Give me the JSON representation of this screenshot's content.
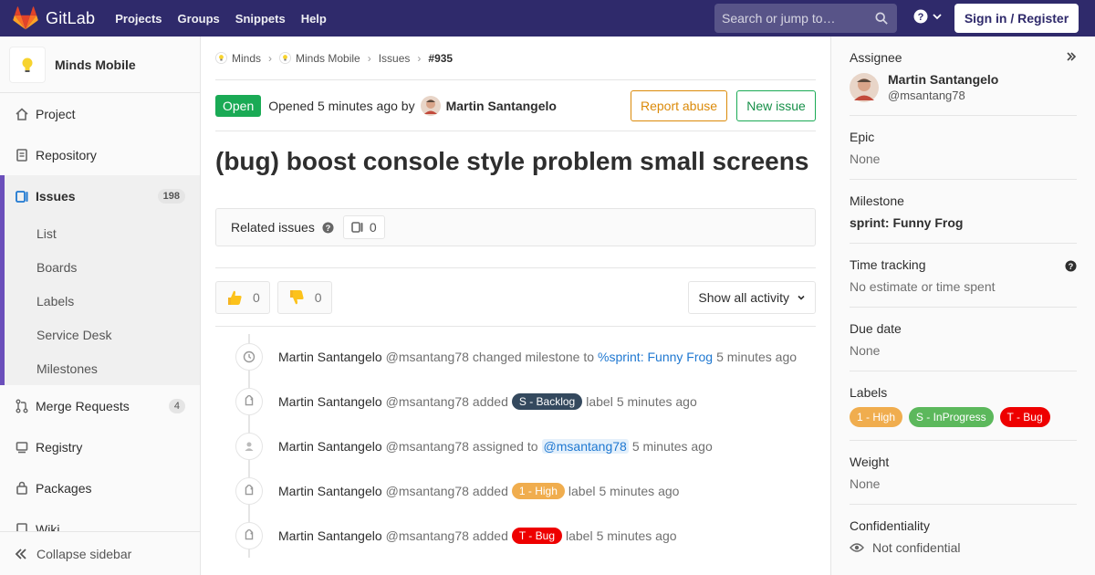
{
  "topbar": {
    "brand": "GitLab",
    "nav": [
      "Projects",
      "Groups",
      "Snippets",
      "Help"
    ],
    "search_placeholder": "Search or jump to…",
    "signin": "Sign in / Register"
  },
  "sidebar": {
    "project_name": "Minds Mobile",
    "items": [
      {
        "label": "Project",
        "icon": "home-icon"
      },
      {
        "label": "Repository",
        "icon": "doc-icon"
      },
      {
        "label": "Issues",
        "icon": "issues-icon",
        "count": "198",
        "active": true
      }
    ],
    "issue_subitems": [
      "List",
      "Boards",
      "Labels",
      "Service Desk",
      "Milestones"
    ],
    "items_after": [
      {
        "label": "Merge Requests",
        "icon": "merge-request-icon",
        "count": "4"
      },
      {
        "label": "Registry",
        "icon": "registry-icon"
      },
      {
        "label": "Packages",
        "icon": "package-icon"
      },
      {
        "label": "Wiki",
        "icon": "wiki-icon"
      }
    ],
    "collapse": "Collapse sidebar"
  },
  "breadcrumb": {
    "group": "Minds",
    "project": "Minds Mobile",
    "section": "Issues",
    "current": "#935"
  },
  "issue": {
    "status": "Open",
    "opened_text": "Opened 5 minutes ago by",
    "author": "Martin Santangelo",
    "report_abuse": "Report abuse",
    "new_issue": "New issue",
    "title": "(bug) boost console style problem small screens",
    "related_label": "Related issues",
    "related_count": "0",
    "thumbs_up": "0",
    "thumbs_down": "0",
    "activity_filter": "Show all activity"
  },
  "timeline": [
    {
      "icon": "clock-icon",
      "who": "Martin Santangelo",
      "handle": "@msantang78",
      "pre": "changed milestone to",
      "link": "%sprint: Funny Frog",
      "time": "5 minutes ago"
    },
    {
      "icon": "tag-icon",
      "who": "Martin Santangelo",
      "handle": "@msantang78",
      "pre": "added",
      "label": "S - Backlog",
      "label_color": "#34495e",
      "post": "label",
      "time": "5 minutes ago"
    },
    {
      "icon": "user-icon",
      "who": "Martin Santangelo",
      "handle": "@msantang78",
      "pre": "assigned to",
      "mention": "@msantang78",
      "time": "5 minutes ago"
    },
    {
      "icon": "tag-icon",
      "who": "Martin Santangelo",
      "handle": "@msantang78",
      "pre": "added",
      "label": "1 - High",
      "label_color": "#f0ad4e",
      "post": "label",
      "time": "5 minutes ago"
    },
    {
      "icon": "tag-icon",
      "who": "Martin Santangelo",
      "handle": "@msantang78",
      "pre": "added",
      "label": "T - Bug",
      "label_color": "#ee0000",
      "post": "label",
      "time": "5 minutes ago"
    }
  ],
  "right_sidebar": {
    "assignee_title": "Assignee",
    "assignee_name": "Martin Santangelo",
    "assignee_handle": "@msantang78",
    "epic_title": "Epic",
    "epic_value": "None",
    "milestone_title": "Milestone",
    "milestone_value": "sprint: Funny Frog",
    "time_title": "Time tracking",
    "time_value": "No estimate or time spent",
    "due_title": "Due date",
    "due_value": "None",
    "labels_title": "Labels",
    "labels": [
      {
        "text": "1 - High",
        "color": "#f0ad4e"
      },
      {
        "text": "S - InProgress",
        "color": "#5cb85c"
      },
      {
        "text": "T - Bug",
        "color": "#ee0000"
      }
    ],
    "weight_title": "Weight",
    "weight_value": "None",
    "confidentiality_title": "Confidentiality",
    "confidentiality_value": "Not confidential"
  }
}
